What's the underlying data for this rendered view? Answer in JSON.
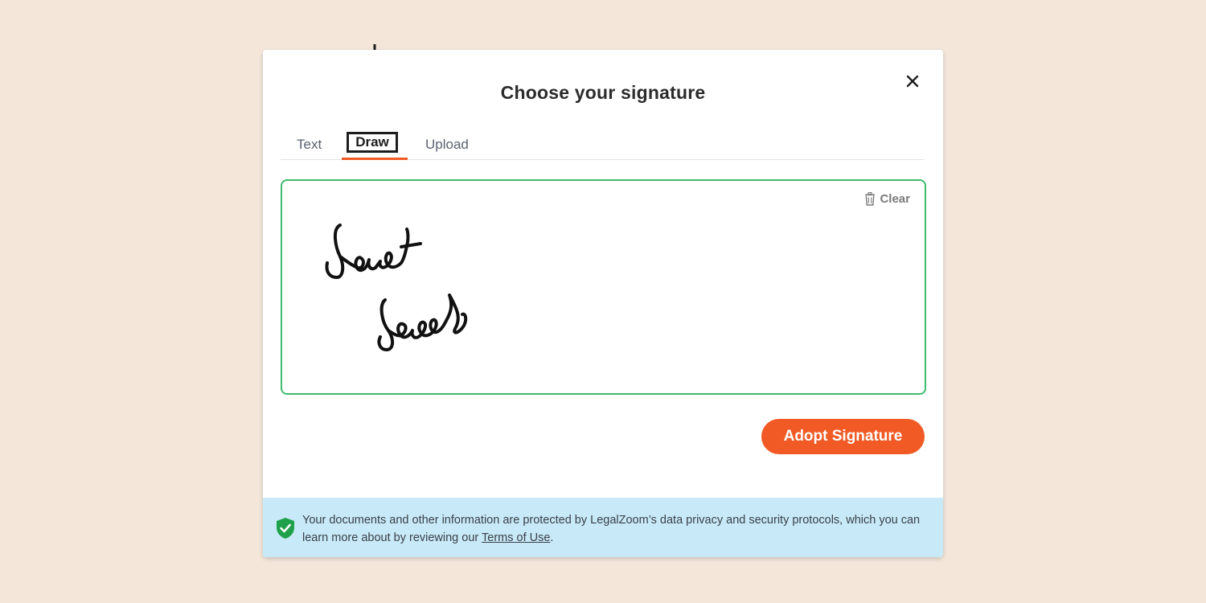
{
  "modal": {
    "title": "Choose your signature",
    "close_icon": "close-icon"
  },
  "tabs": [
    {
      "label": "Text",
      "active": false
    },
    {
      "label": "Draw",
      "active": true
    },
    {
      "label": "Upload",
      "active": false
    }
  ],
  "draw_area": {
    "clear_label": "Clear",
    "clear_icon": "trash-icon",
    "signature": "handwritten signature drawing"
  },
  "actions": {
    "adopt_label": "Adopt Signature"
  },
  "footer": {
    "icon": "shield-check-icon",
    "text_before": "Your documents and other information are protected by LegalZoom’s data privacy and security protocols, which you can learn more about by reviewing our ",
    "link_label": "Terms of Use",
    "text_after": "."
  },
  "colors": {
    "accent": "#f15a24",
    "draw_border": "#3dbb6b",
    "footer_bg": "#c8eaf8",
    "page_bg": "#f4e7da",
    "shield": "#1fa04a"
  }
}
